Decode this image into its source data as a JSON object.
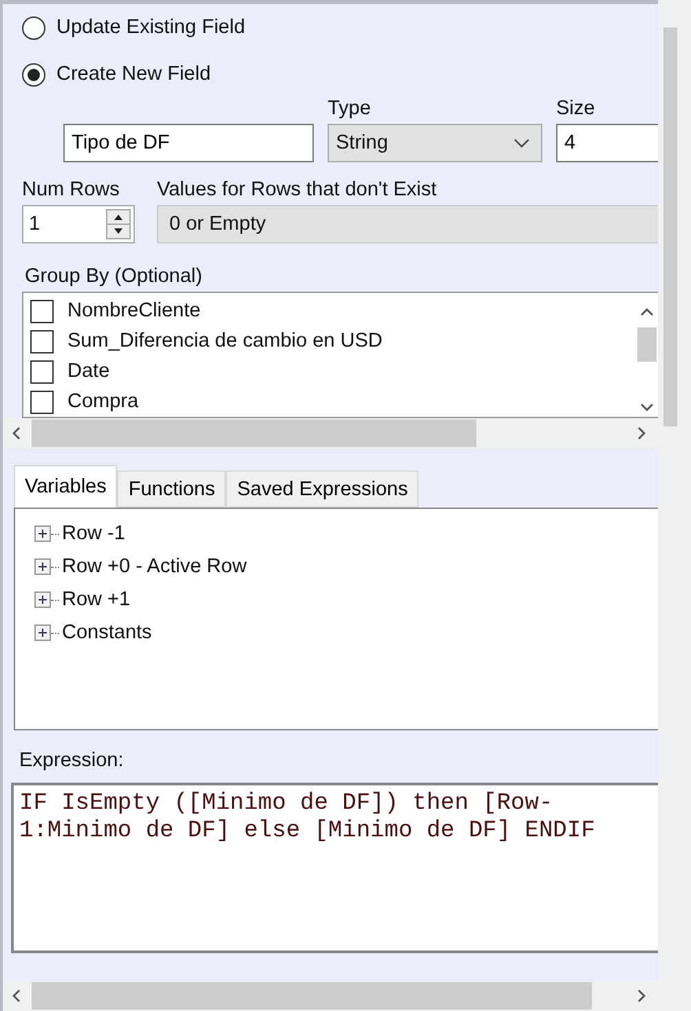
{
  "radio_options": [
    {
      "label": "Update Existing Field",
      "selected": false
    },
    {
      "label": "Create New  Field",
      "selected": true
    }
  ],
  "new_field": {
    "name": "Tipo de DF",
    "type_label": "Type",
    "type": "String",
    "size_label": "Size",
    "size": "4"
  },
  "num_rows": {
    "label": "Num Rows",
    "value": "1"
  },
  "missing_values": {
    "label": "Values for Rows that don't Exist",
    "value": "0 or Empty"
  },
  "group_by": {
    "label": "Group By (Optional)",
    "items": [
      {
        "label": "NombreCliente",
        "checked": false
      },
      {
        "label": "Sum_Diferencia de cambio en USD",
        "checked": false
      },
      {
        "label": "Date",
        "checked": false
      },
      {
        "label": "Compra",
        "checked": false
      }
    ]
  },
  "tabs": [
    {
      "label": "Variables",
      "selected": true
    },
    {
      "label": "Functions",
      "selected": false
    },
    {
      "label": "Saved Expressions",
      "selected": false
    }
  ],
  "variables_tree": [
    {
      "label": "Row -1",
      "expanded": false
    },
    {
      "label": "Row +0 - Active Row",
      "expanded": false
    },
    {
      "label": "Row +1",
      "expanded": false
    },
    {
      "label": "Constants",
      "expanded": false
    }
  ],
  "expression": {
    "label": "Expression:",
    "value": "IF IsEmpty ([Minimo de DF]) then [Row-1:Minimo de DF] else [Minimo de DF] ENDIF"
  }
}
